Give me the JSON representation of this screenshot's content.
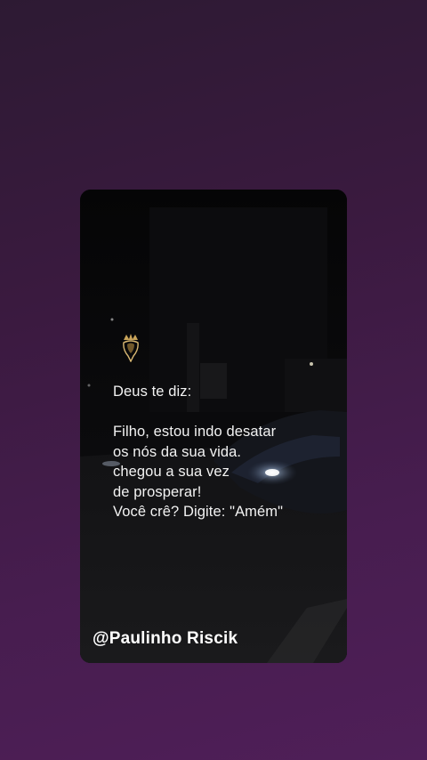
{
  "story": {
    "message_lines": [
      "Deus te diz:",
      "",
      "Filho, estou indo desatar",
      "os nós da sua vida.",
      "chegou a sua vez",
      "de prosperar!",
      "Você crê? Digite: \"Amém\""
    ],
    "author_handle": "@Paulinho Riscik",
    "logo_icon": "crown-eagle-icon"
  },
  "colors": {
    "background_top": "#2d1a33",
    "background_bottom": "#4f1f58",
    "card": "#060607",
    "text": "#f2f2f2",
    "logo_gold": "#c9a45a"
  }
}
